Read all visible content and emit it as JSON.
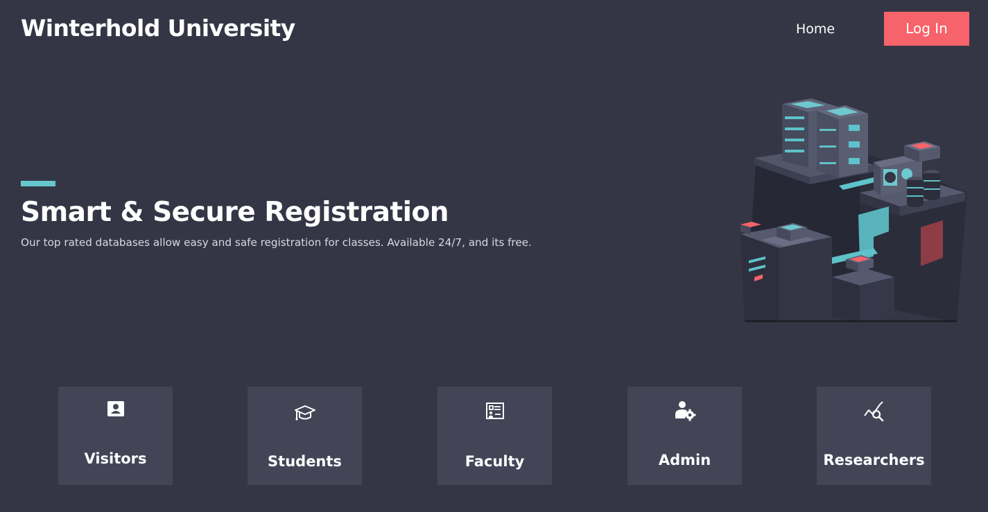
{
  "header": {
    "brand": "Winterhold University",
    "nav_home": "Home",
    "login_label": "Log In"
  },
  "hero": {
    "title": "Smart & Secure Registration",
    "subtitle": "Our top rated databases allow easy and safe registration for classes. Available 24/7, and its free."
  },
  "cards": [
    {
      "label": "Visitors",
      "icon": "contact-card-icon"
    },
    {
      "label": "Students",
      "icon": "graduation-cap-icon"
    },
    {
      "label": "Faculty",
      "icon": "whiteboard-presentation-icon"
    },
    {
      "label": "Admin",
      "icon": "user-gear-icon"
    },
    {
      "label": "Researchers",
      "icon": "chart-search-icon"
    }
  ],
  "colors": {
    "background": "#343645",
    "card": "#434557",
    "accent": "#f7636a",
    "teal": "#66c6cc"
  }
}
